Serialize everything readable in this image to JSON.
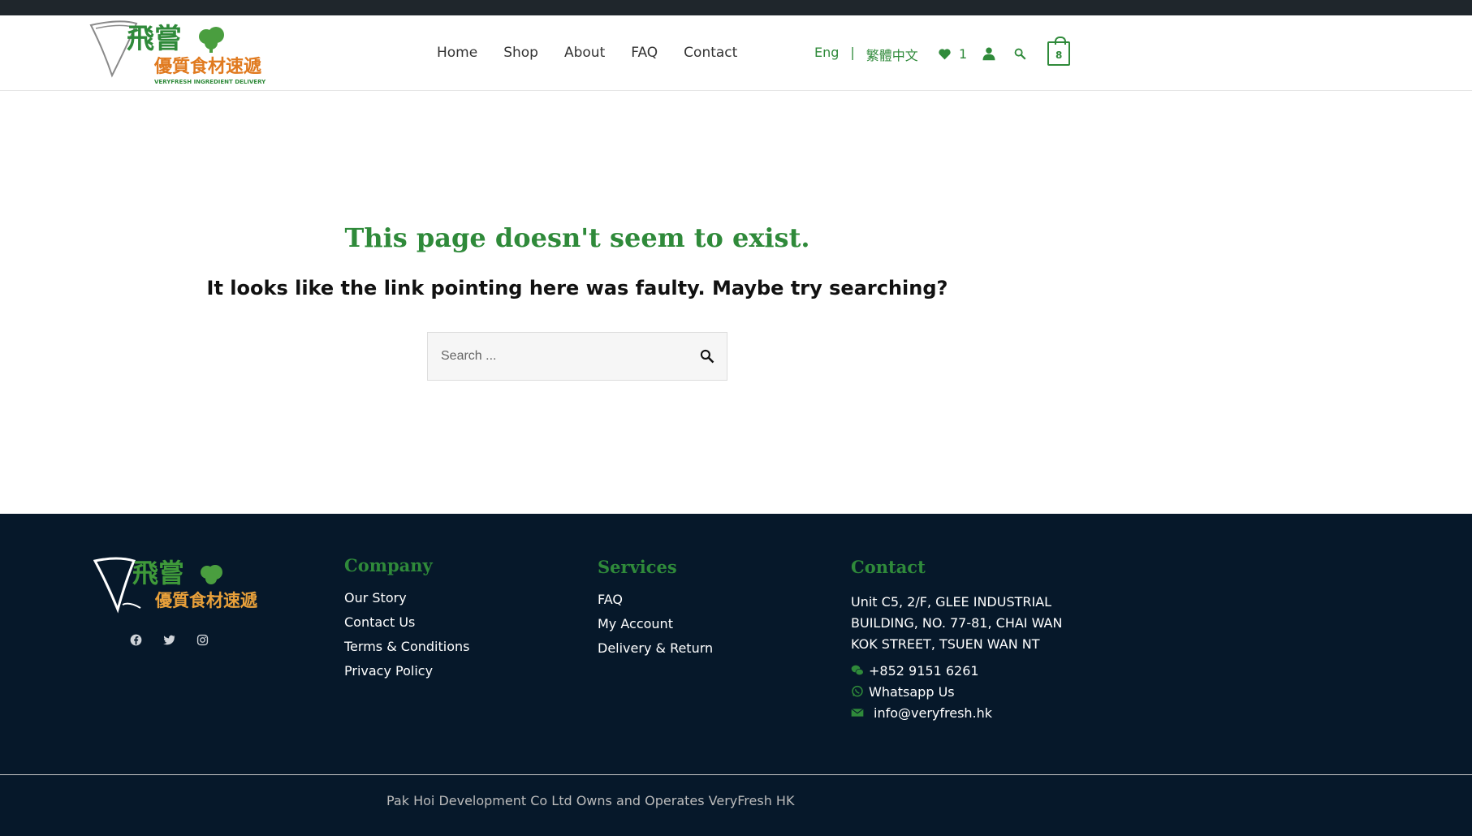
{
  "brand": {
    "logo_chinese_top": "飛嘗",
    "logo_chinese_bottom": "優質食材速遞",
    "logo_english": "VERYFRESH INGREDIENT DELIVERY",
    "accent_color": "#2f8a3a",
    "secondary_color": "#e07a1f"
  },
  "nav": {
    "items": [
      "Home",
      "Shop",
      "About",
      "FAQ",
      "Contact"
    ]
  },
  "lang": {
    "english": "Eng",
    "separator": "|",
    "chinese": "繁體中文"
  },
  "header_icons": {
    "wishlist_icon": "heart-icon",
    "wishlist_count": "1",
    "account_icon": "user-icon",
    "search_icon": "search-icon",
    "cart_icon": "shopping-bag-icon",
    "cart_count": "8"
  },
  "main": {
    "title": "This page doesn't seem to exist.",
    "subtitle": "It looks like the link pointing here was faulty. Maybe try searching?",
    "search_placeholder": "Search ..."
  },
  "footer": {
    "socials": [
      "facebook-icon",
      "twitter-icon",
      "instagram-icon"
    ],
    "company": {
      "heading": "Company",
      "links": [
        "Our Story",
        "Contact Us",
        "Terms & Conditions",
        "Privacy Policy"
      ]
    },
    "services": {
      "heading": "Services",
      "links": [
        "FAQ",
        "My Account",
        "Delivery & Return"
      ]
    },
    "contact": {
      "heading": "Contact",
      "address_lines": [
        "Unit C5, 2/F, GLEE INDUSTRIAL",
        "BUILDING, NO. 77-81, CHAI WAN",
        "KOK STREET, TSUEN WAN NT"
      ],
      "phone": "+852 9151 6261",
      "whatsapp": "Whatsapp Us",
      "email": "info@veryfresh.hk"
    },
    "copyright": "Pak Hoi Development Co Ltd Owns and Operates VeryFresh HK"
  }
}
